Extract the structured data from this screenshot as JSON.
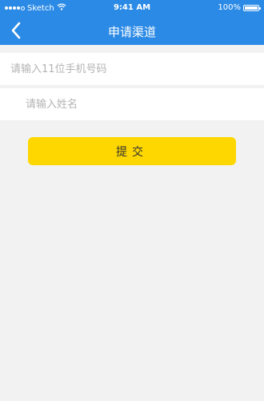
{
  "status_bar": {
    "carrier": "Sketch",
    "time": "9:41 AM",
    "battery": "100%",
    "battery_level": 1.0
  },
  "nav": {
    "title": "申请渠道",
    "back_icon": "chevron-left-icon"
  },
  "form": {
    "phone_placeholder": "请输入11位手机号码",
    "phone_value": "",
    "name_placeholder": "请输入姓名",
    "name_value": "",
    "submit_label": "提交"
  },
  "colors": {
    "header": "#2b8ae6",
    "submit": "#fed700",
    "background": "#f2f2f2"
  }
}
